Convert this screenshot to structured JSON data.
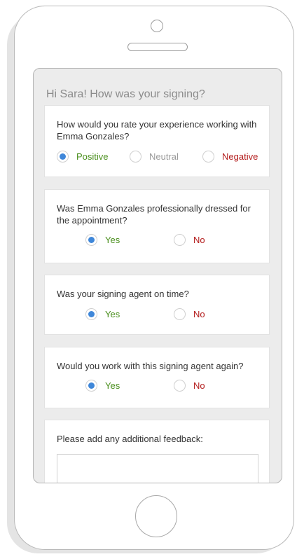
{
  "survey": {
    "greeting": "Hi Sara! How was your signing?",
    "questions": [
      {
        "text": "How would you rate your experience working with Emma Gonzales?",
        "options": [
          {
            "label": "Positive",
            "selected": true
          },
          {
            "label": "Neutral",
            "selected": false
          },
          {
            "label": "Negative",
            "selected": false
          }
        ]
      },
      {
        "text": "Was Emma Gonzales professionally dressed for the appointment?",
        "options": [
          {
            "label": "Yes",
            "selected": true
          },
          {
            "label": "No",
            "selected": false
          }
        ]
      },
      {
        "text": "Was your signing agent on time?",
        "options": [
          {
            "label": "Yes",
            "selected": true
          },
          {
            "label": "No",
            "selected": false
          }
        ]
      },
      {
        "text": "Would you work with this signing agent again?",
        "options": [
          {
            "label": "Yes",
            "selected": true
          },
          {
            "label": "No",
            "selected": false
          }
        ]
      }
    ],
    "feedback": {
      "label": "Please add any additional feedback:",
      "value": ""
    }
  },
  "colors": {
    "selected_radio": "#3f87d9",
    "positive": "#4a8f1d",
    "neutral": "#9a9a9a",
    "negative": "#b31b1b"
  }
}
